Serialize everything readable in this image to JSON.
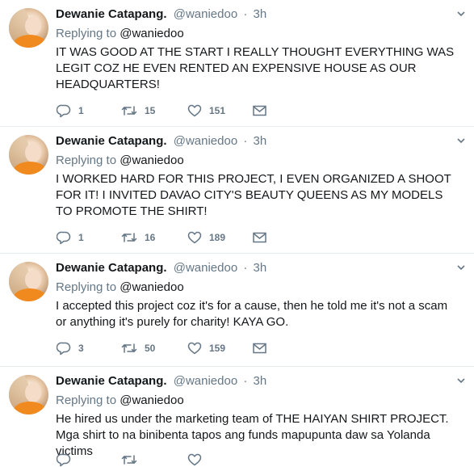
{
  "tweets": [
    {
      "name": "Dewanie Catapang.",
      "handle": "@waniedoo",
      "dot": "·",
      "time": "3h",
      "replying_label": "Replying to",
      "replying_to": "@waniedoo",
      "text": "IT WAS GOOD AT THE START I REALLY THOUGHT EVERYTHING WAS LEGIT COZ HE EVEN RENTED AN EXPENSIVE HOUSE AS OUR HEADQUARTERS!",
      "replies": "1",
      "retweets": "15",
      "likes": "151"
    },
    {
      "name": "Dewanie Catapang.",
      "handle": "@waniedoo",
      "dot": "·",
      "time": "3h",
      "replying_label": "Replying to",
      "replying_to": "@waniedoo",
      "text": "I WORKED HARD FOR THIS PROJECT, I EVEN ORGANIZED A SHOOT FOR IT! I INVITED DAVAO CITY'S BEAUTY QUEENS AS MY MODELS TO PROMOTE THE SHIRT!",
      "replies": "1",
      "retweets": "16",
      "likes": "189"
    },
    {
      "name": "Dewanie Catapang.",
      "handle": "@waniedoo",
      "dot": "·",
      "time": "3h",
      "replying_label": "Replying to",
      "replying_to": "@waniedoo",
      "text": "I accepted this project coz it's for a cause, then he told me it's not a scam or anything it's purely for charity! KAYA GO.",
      "replies": "3",
      "retweets": "50",
      "likes": "159"
    },
    {
      "name": "Dewanie Catapang.",
      "handle": "@waniedoo",
      "dot": "·",
      "time": "3h",
      "replying_label": "Replying to",
      "replying_to": "@waniedoo",
      "text": "He hired us under the marketing team of THE HAIYAN SHIRT PROJECT. Mga shirt to na binibenta tapos ang funds mapupunta daw sa Yolanda victims"
    }
  ],
  "colors": {
    "text": "#14171a",
    "secondary": "#657786",
    "divider": "#e6ecf0"
  },
  "icons": [
    "reply-icon",
    "retweet-icon",
    "like-icon",
    "direct-message-icon",
    "chevron-down-icon"
  ]
}
